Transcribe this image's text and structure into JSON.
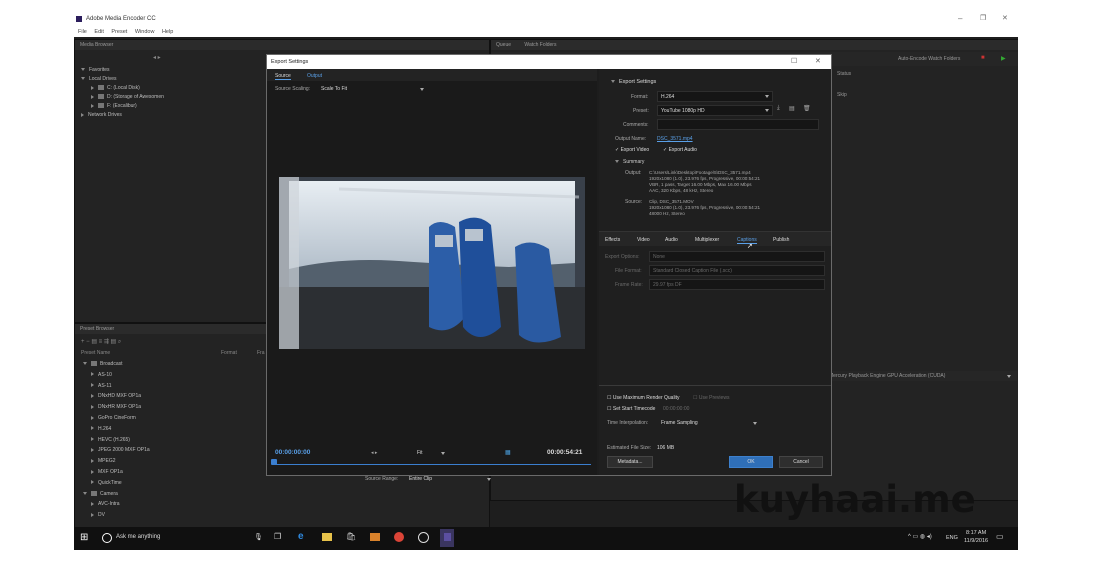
{
  "window": {
    "title": "Adobe Media Encoder CC",
    "menu": [
      "File",
      "Edit",
      "Preset",
      "Window",
      "Help"
    ]
  },
  "media_browser": {
    "title": "Media Browser",
    "favorites": "Favorites",
    "local_drives": "Local Drives",
    "drives": [
      "C: (Local Disk)",
      "D: (Storage of Awesomen",
      "F: (Excalibur)"
    ],
    "network_drives": "Network Drives"
  },
  "queue_panel": {
    "tabs": [
      "Queue",
      "Watch Folders"
    ],
    "auto_encode": "Auto-Encode Watch Folders",
    "status_header": "Status",
    "skip": "Skip",
    "renderer": "Mercury Playback Engine GPU Acceleration (CUDA)"
  },
  "preset_browser": {
    "title": "Preset Browser",
    "columns": [
      "Preset Name",
      "Format",
      "Fra"
    ],
    "items": [
      {
        "label": "Broadcast",
        "level": 0,
        "open": true,
        "folder": true
      },
      {
        "label": "AS-10",
        "level": 1
      },
      {
        "label": "AS-11",
        "level": 1
      },
      {
        "label": "DNxHD MXF OP1a",
        "level": 1
      },
      {
        "label": "DNxHR MXF OP1a",
        "level": 1
      },
      {
        "label": "GoPro CineForm",
        "level": 1
      },
      {
        "label": "H.264",
        "level": 1
      },
      {
        "label": "HEVC (H.265)",
        "level": 1
      },
      {
        "label": "JPEG 2000 MXF OP1a",
        "level": 1
      },
      {
        "label": "MPEG2",
        "level": 1
      },
      {
        "label": "MXF OP1a",
        "level": 1
      },
      {
        "label": "QuickTime",
        "level": 1
      },
      {
        "label": "Camera",
        "level": 0,
        "open": true,
        "folder": true
      },
      {
        "label": "AVC-Intra",
        "level": 1
      },
      {
        "label": "DV",
        "level": 1
      }
    ]
  },
  "dialog": {
    "title": "Export Settings",
    "source_tabs": [
      "Source",
      "Output"
    ],
    "source_scaling_label": "Source Scaling:",
    "source_scaling_value": "Scale To Fit",
    "timecode_start": "00:00:00:00",
    "timecode_end": "00:00:54:21",
    "fit_value": "Fit",
    "source_range_label": "Source Range:",
    "source_range_value": "Entire Clip",
    "export_settings_header": "Export Settings",
    "format_label": "Format:",
    "format_value": "H.264",
    "preset_label": "Preset:",
    "preset_value": "YouTube 1080p HD",
    "comments_label": "Comments:",
    "output_name_label": "Output Name:",
    "output_name_value": "DSC_3571.mp4",
    "export_video": "Export Video",
    "export_audio": "Export Audio",
    "summary_header": "Summary",
    "summary_output_label": "Output:",
    "summary_output_lines": [
      "C:\\Users\\Link\\Desktop\\Footage\\5\\DSC_3571.mp4",
      "1920x1080 (1.0), 23.976 fps, Progressive, 00:00:54:21",
      "VBR, 1 pass, Target 16.00 Mbps, Max 16.00 Mbps",
      "AAC, 320 Kbps, 48 kHz, Stereo"
    ],
    "summary_source_label": "Source:",
    "summary_source_lines": [
      "Clip, DSC_3571.MOV",
      "1920x1080 (1.0), 23.976 fps, Progressive, 00:00:54:21",
      "48000 Hz, Stereo"
    ],
    "tabs": [
      "Effects",
      "Video",
      "Audio",
      "Multiplexer",
      "Captions",
      "Publish"
    ],
    "active_tab": "Captions",
    "export_options_label": "Export Options:",
    "export_options_value": "None",
    "file_format_label": "File Format:",
    "file_format_value": "Standard Closed Caption File (.scc)",
    "frame_rate_label": "Frame Rate:",
    "frame_rate_value": "29.97 fps DF",
    "use_max_render": "Use Maximum Render Quality",
    "use_previews": "Use Previews",
    "set_start_timecode": "Set Start Timecode",
    "start_timecode_value": "00:00:00:00",
    "time_interpolation_label": "Time Interpolation:",
    "time_interpolation_value": "Frame Sampling",
    "file_size_label": "Estimated File Size:",
    "file_size_value": "106 MB",
    "metadata_button": "Metadata...",
    "ok_button": "OK",
    "cancel_button": "Cancel"
  },
  "taskbar": {
    "search_placeholder": "Ask me anything",
    "lang": "ENG",
    "time": "8:17 AM",
    "date": "11/9/2016"
  },
  "watermark": "kuyhaai.me",
  "colors": {
    "accent_blue": "#2f6fb8",
    "link_blue": "#5aa0e8",
    "panel_dark": "#232323"
  }
}
